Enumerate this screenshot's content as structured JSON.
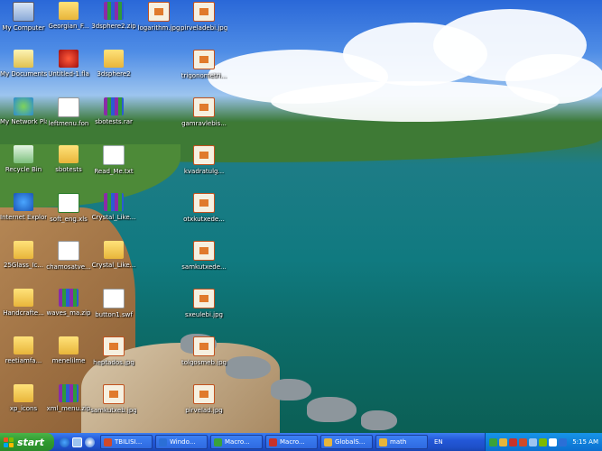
{
  "desktop": {
    "icons": [
      {
        "label": "My Computer",
        "glyph": "computer"
      },
      {
        "label": "Georgian_F...",
        "glyph": "folder"
      },
      {
        "label": "3dsphere2.zip",
        "glyph": "archive"
      },
      {
        "label": "logarithm.jpg",
        "glyph": "image"
      },
      {
        "label": "pirveladebi.jpg",
        "glyph": "image"
      },
      {
        "label": "My Documents",
        "glyph": "docs"
      },
      {
        "label": "Untitled-1.fla",
        "glyph": "red"
      },
      {
        "label": "3dsphere2",
        "glyph": "folder"
      },
      {
        "label": "trigonometri...",
        "glyph": "image"
      },
      {
        "label": "My Network Places",
        "glyph": "network"
      },
      {
        "label": "leftmenu.fon",
        "glyph": "shortcut"
      },
      {
        "label": "sbotests.rar",
        "glyph": "archive"
      },
      {
        "label": "gamravlebis...",
        "glyph": "image"
      },
      {
        "label": "Recycle Bin",
        "glyph": "recycle"
      },
      {
        "label": "sbotests",
        "glyph": "folder"
      },
      {
        "label": "Read_Me.txt",
        "glyph": "text"
      },
      {
        "label": "kvadratulg...",
        "glyph": "image"
      },
      {
        "label": "Internet Explorer",
        "glyph": "ie"
      },
      {
        "label": "soft_eng.xls",
        "glyph": "excel"
      },
      {
        "label": "Crystal_Like...",
        "glyph": "archive"
      },
      {
        "label": "otxkutxede...",
        "glyph": "image"
      },
      {
        "label": "25Glass_Ic...",
        "glyph": "folder"
      },
      {
        "label": "chamosatve...",
        "glyph": "shortcut"
      },
      {
        "label": "Crystal_Like...",
        "glyph": "folder"
      },
      {
        "label": "samkutxede...",
        "glyph": "image"
      },
      {
        "label": "Handcrafte...",
        "glyph": "folder"
      },
      {
        "label": "waves_ma.zip",
        "glyph": "archive"
      },
      {
        "label": "button1.swf",
        "glyph": "swf"
      },
      {
        "label": "sxeulebi.jpg",
        "glyph": "image"
      },
      {
        "label": "reetiamfa...",
        "glyph": "folder"
      },
      {
        "label": "menelilme",
        "glyph": "folder"
      },
      {
        "label": "heptados.jpg",
        "glyph": "image"
      },
      {
        "label": "tolgosmeb.jpg",
        "glyph": "image"
      },
      {
        "label": "xp_icons",
        "glyph": "folder"
      },
      {
        "label": "xml_menu.zip",
        "glyph": "archive"
      },
      {
        "label": "samkutxeb.jpg",
        "glyph": "image"
      },
      {
        "label": "pirvelad.jpg",
        "glyph": "image"
      }
    ]
  },
  "taskbar": {
    "start_label": "start",
    "tasks": [
      {
        "label": "TBILISI...",
        "color": "#d04a2a"
      },
      {
        "label": "Windo...",
        "color": "#2b6fd6"
      },
      {
        "label": "Macro...",
        "color": "#3aa23a"
      },
      {
        "label": "Macro...",
        "color": "#c8322a"
      },
      {
        "label": "GlobalS...",
        "color": "#e8b53a"
      },
      {
        "label": "math",
        "color": "#e8b53a"
      }
    ],
    "language": "EN",
    "clock": "5:15 AM"
  }
}
